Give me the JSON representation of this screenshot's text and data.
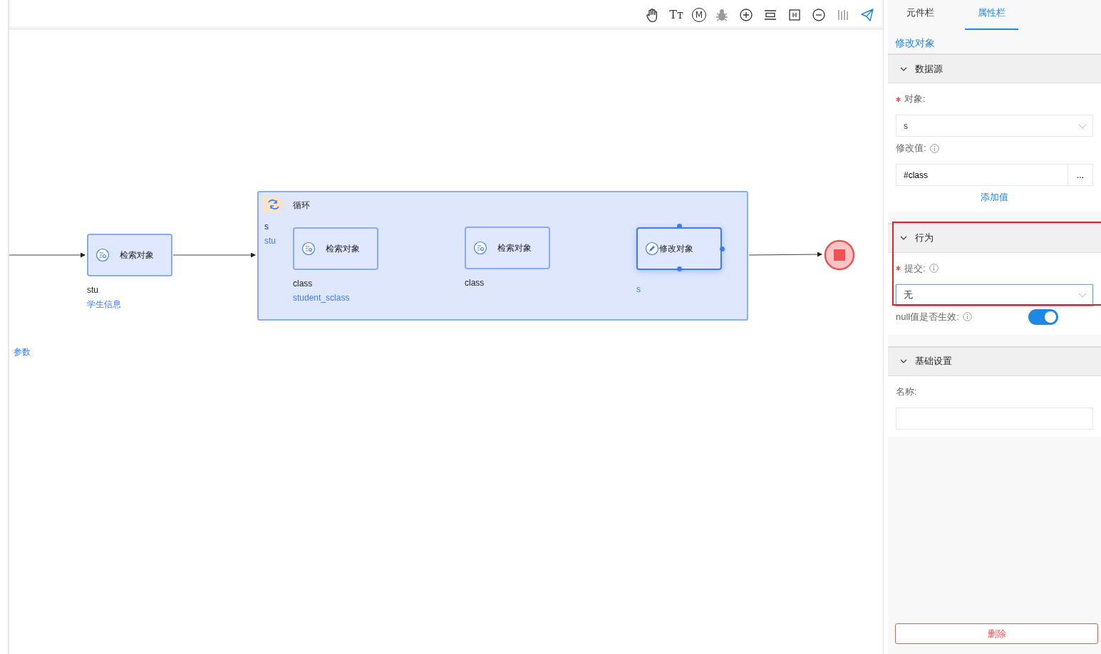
{
  "left_panel": {
    "label": "参数"
  },
  "toolbar": [
    {
      "kind": "hand"
    },
    {
      "kind": "text",
      "label": "Tт"
    },
    {
      "kind": "circle-letter",
      "label": "M"
    },
    {
      "kind": "bug",
      "disabled": true
    },
    {
      "kind": "plus"
    },
    {
      "kind": "rows"
    },
    {
      "kind": "frame"
    },
    {
      "kind": "minus"
    },
    {
      "kind": "bars",
      "disabled": true
    },
    {
      "kind": "send",
      "active": true
    }
  ],
  "canvas": {
    "nodes": [
      {
        "kind": "search",
        "label": "检索对象",
        "var": "stu",
        "source": "学生信息",
        "selected": false
      },
      {
        "kind": "loop",
        "label": "循环",
        "var": "s",
        "source": "stu",
        "children": [
          {
            "kind": "search",
            "label": "检索对象",
            "var": "class",
            "source": "student_sclass",
            "selected": false
          },
          {
            "kind": "search",
            "label": "检索对象",
            "var": "class",
            "selected": false
          },
          {
            "kind": "edit",
            "label": "修改对象",
            "source": "s",
            "selected": true
          }
        ]
      },
      {
        "kind": "end"
      }
    ]
  },
  "properties": {
    "tabs": [
      {
        "label": "元件栏",
        "selected": false
      },
      {
        "label": "属性栏",
        "selected": true
      }
    ],
    "title": "修改对象",
    "sections": [
      {
        "title": "数据源",
        "expanded": true,
        "highlighted": false,
        "fields": [
          {
            "kind": "select",
            "label": "对象:",
            "required": true,
            "value": "s"
          },
          {
            "kind": "input-button",
            "label": "修改值:",
            "info": true,
            "value": "#class",
            "button": "...",
            "link": "添加值"
          }
        ]
      },
      {
        "title": "行为",
        "expanded": true,
        "highlighted": true,
        "fields": [
          {
            "kind": "select",
            "label": "提交:",
            "required": true,
            "info": true,
            "value": "无",
            "focused": true
          },
          {
            "kind": "switch",
            "label": "null值是否生效:",
            "info": true,
            "on": true
          }
        ]
      },
      {
        "title": "基础设置",
        "expanded": true,
        "highlighted": false,
        "fields": [
          {
            "kind": "input",
            "label": "名称:"
          }
        ]
      }
    ],
    "delete_button": "删除"
  }
}
